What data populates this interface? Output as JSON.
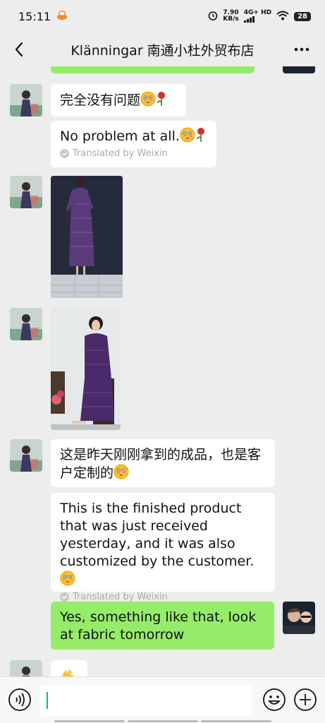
{
  "status": {
    "time": "15:11",
    "speed_value": "7.90",
    "speed_unit": "KB/s",
    "network": "4G+ HD",
    "battery": "28"
  },
  "header": {
    "title": "Klänningar 南通小杜外贸布店"
  },
  "messages": [
    {
      "sender": "contact",
      "type": "text",
      "text": "完全没有问题"
    },
    {
      "sender": "contact",
      "type": "translation",
      "text": "No problem at all.",
      "note": "Translated by Weixin"
    },
    {
      "sender": "contact",
      "type": "image",
      "description": "purple-qipao-dress-photo"
    },
    {
      "sender": "contact",
      "type": "image",
      "description": "woman-wearing-purple-qipao-photo"
    },
    {
      "sender": "contact",
      "type": "text",
      "text": "这是昨天刚刚拿到的成品，也是客户定制的"
    },
    {
      "sender": "contact",
      "type": "translation",
      "text": "This is the finished product that was just received yesterday, and it was also customized by the customer.",
      "note": "Translated by Weixin"
    },
    {
      "sender": "me",
      "type": "text",
      "text": "Yes, something like that, look at fabric tomorrow"
    }
  ],
  "input": {
    "value": ""
  },
  "colors": {
    "background": "#ededed",
    "my_bubble": "#95ec69",
    "their_bubble": "#ffffff",
    "accent": "#07c160"
  }
}
